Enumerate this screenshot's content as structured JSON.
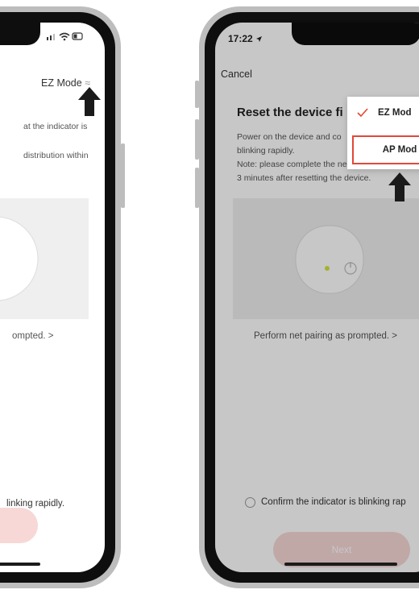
{
  "left_phone": {
    "mode_label": "EZ Mode",
    "mode_icon": "≈",
    "desc_line1": "at the indicator is",
    "desc_line2": "distribution within",
    "prompt_link": "ompted. >",
    "confirm_text": "linking rapidly."
  },
  "right_phone": {
    "time": "17:22",
    "location_icon": "navigation-arrow-icon",
    "cancel_label": "Cancel",
    "mode_label_partial": "E",
    "title": "Reset the device fi",
    "desc_line1": "Power on the device and co",
    "desc_line2": "blinking rapidly.",
    "note_line1": "Note: please complete the ne",
    "note_line2": "3 minutes after resetting the device.",
    "prompt_link": "Perform net pairing as prompted. >",
    "confirm_text": "Confirm the indicator is blinking rap",
    "next_label": "Next",
    "menu": {
      "items": [
        {
          "label": "EZ Mod",
          "checked": true
        },
        {
          "label": "AP Mod",
          "checked": false,
          "highlighted": true
        }
      ],
      "check_icon": "check-icon"
    }
  },
  "colors": {
    "accent": "#e8462c",
    "button_disabled": "#f6d6d3",
    "highlight_border": "#e0483a",
    "indicator": "#d4e33a"
  }
}
